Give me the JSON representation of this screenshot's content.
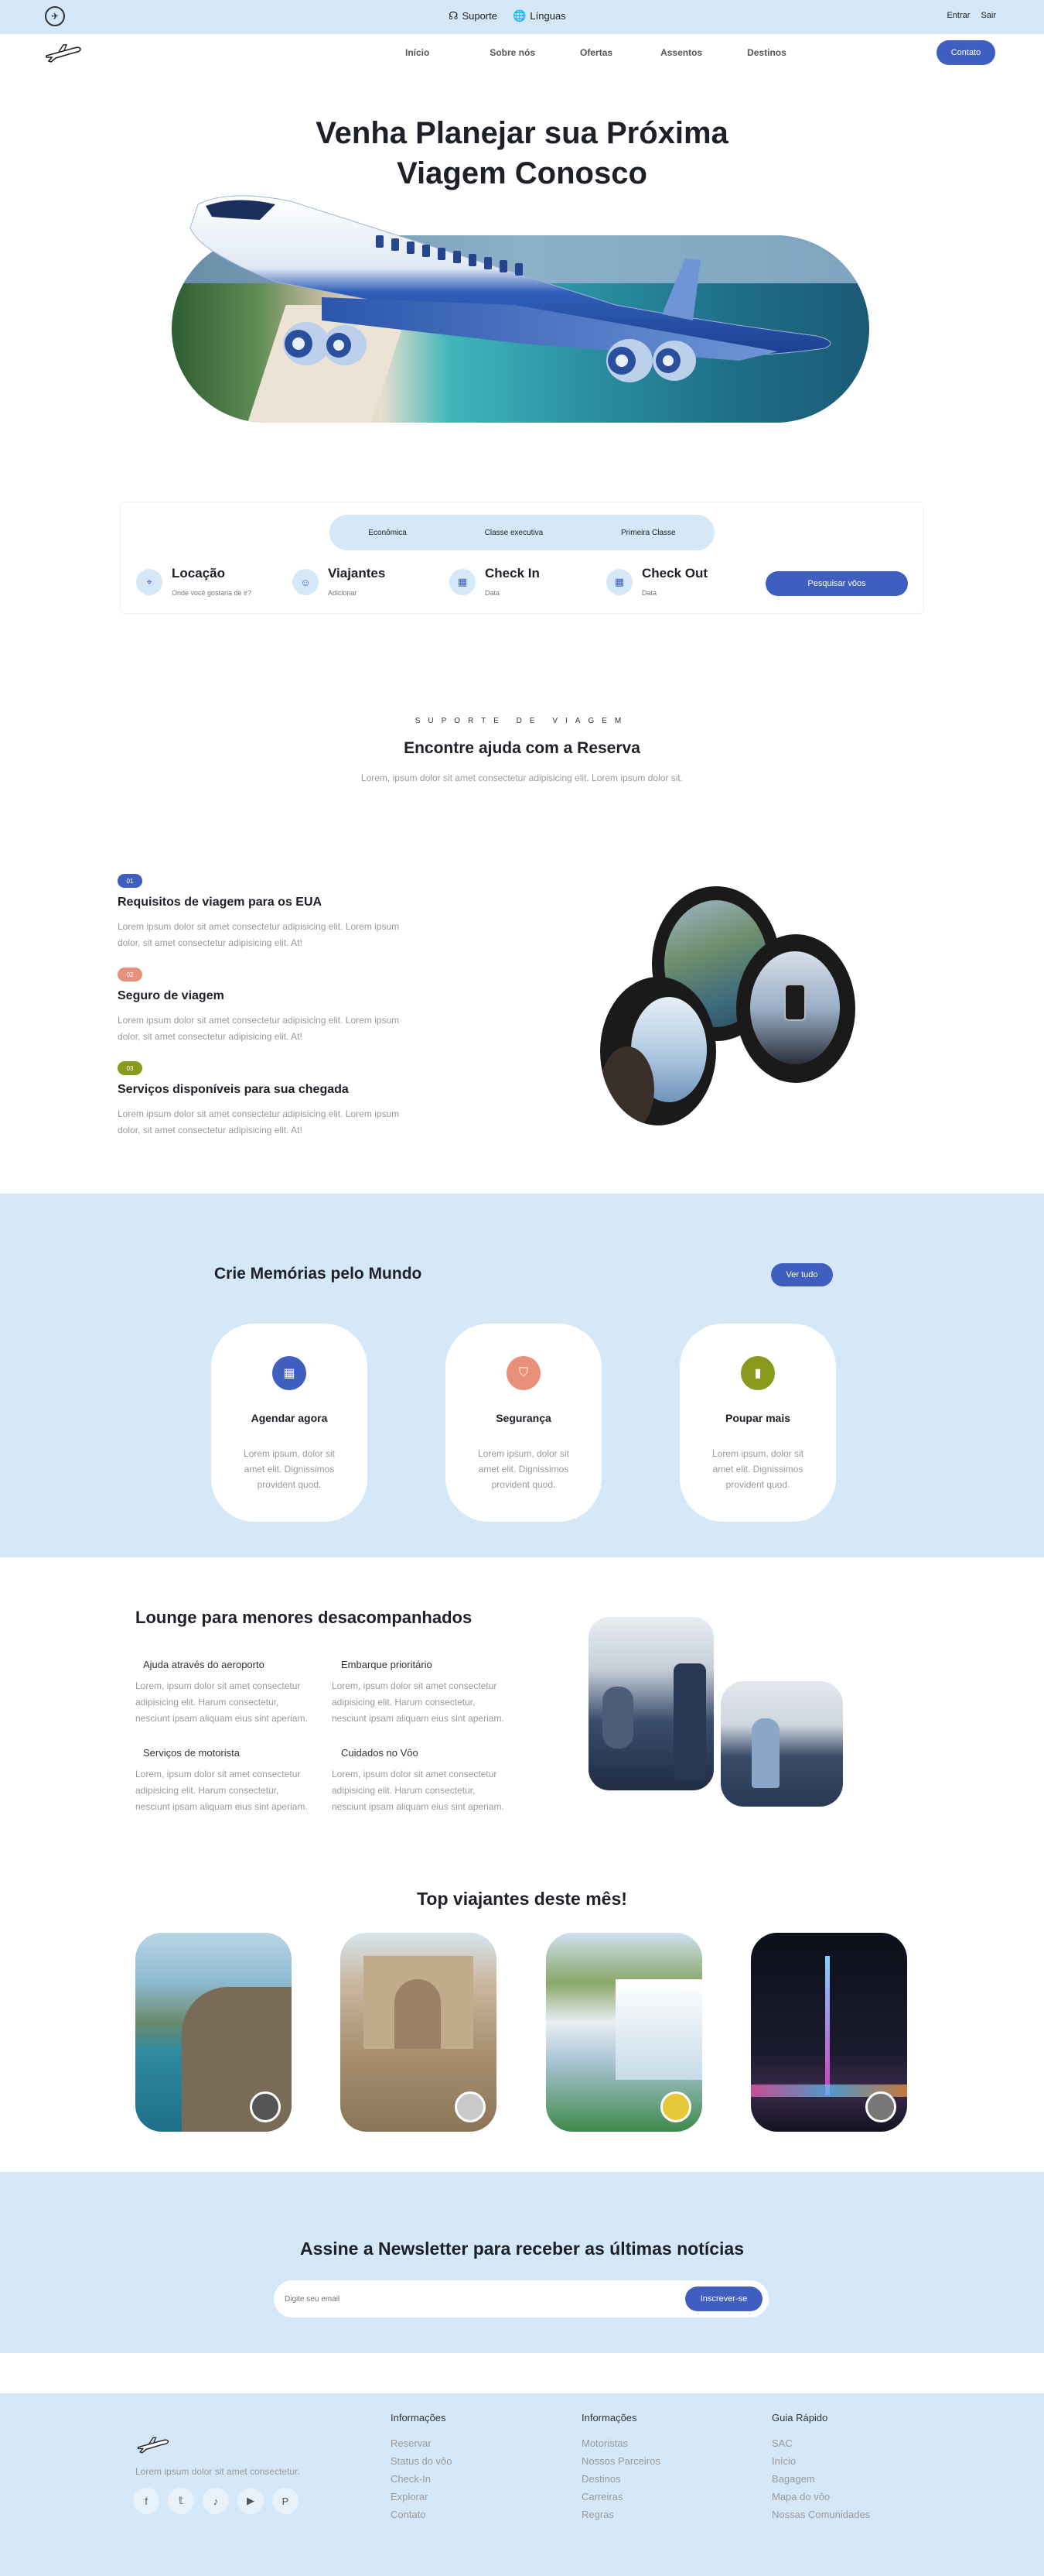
{
  "topbar": {
    "support": "Suporte",
    "languages": "Línguas",
    "login": "Entrar",
    "logout": "Sair"
  },
  "nav": {
    "items": [
      "Início",
      "Sobre nós",
      "Ofertas",
      "Assentos",
      "Destinos"
    ],
    "contact": "Contato"
  },
  "hero": {
    "title_line1": "Venha Planejar sua Próxima",
    "title_line2": "Viagem Conosco"
  },
  "booking": {
    "tabs": [
      "Econômica",
      "Classe executiva",
      "Primeira Classe"
    ],
    "fields": [
      {
        "title": "Locação",
        "sub": "Onde você gostaria de ir?",
        "icon": "map-pin-icon"
      },
      {
        "title": "Viajantes",
        "sub": "Adicionar",
        "icon": "user-icon"
      },
      {
        "title": "Check In",
        "sub": "Data",
        "icon": "calendar-icon"
      },
      {
        "title": "Check Out",
        "sub": "Data",
        "icon": "calendar-icon"
      }
    ],
    "search": "Pesquisar vôos"
  },
  "support": {
    "kicker": "SUPORTE DE VIAGEM",
    "title": "Encontre ajuda com a Reserva",
    "subtitle": "Lorem, ipsum dolor sit amet consectetur adipisicing elit. Lorem ipsum dolor sit.",
    "items": [
      {
        "num": "01",
        "color": "#3f5ebf",
        "title": "Requisitos de viagem para os EUA",
        "text1": "Lorem ipsum dolor sit amet consectetur adipisicing elit. Lorem ipsum",
        "text2": "dolor, sit amet consectetur adipisicing elit. At!"
      },
      {
        "num": "02",
        "color": "#e8907a",
        "title": "Seguro de viagem",
        "text1": "Lorem ipsum dolor sit amet consectetur adipisicing elit. Lorem ipsum",
        "text2": "dolor, sit amet consectetur adipisicing elit. At!"
      },
      {
        "num": "03",
        "color": "#8a9a1d",
        "title": "Serviços disponíveis para sua chegada",
        "text1": "Lorem ipsum dolor sit amet consectetur adipisicing elit. Lorem ipsum",
        "text2": "dolor, sit amet consectetur adipisicing elit. At!"
      }
    ]
  },
  "memories": {
    "title": "Crie Memórias pelo Mundo",
    "see_all": "Ver tudo",
    "cards": [
      {
        "title": "Agendar agora",
        "color": "#3f5ebf",
        "icon": "calendar-icon",
        "l1": "Lorem ipsum, dolor sit",
        "l2": "amet elit. Dignissimos",
        "l3": "provident quod."
      },
      {
        "title": "Segurança",
        "color": "#e8907a",
        "icon": "shield-icon",
        "l1": "Lorem ipsum, dolor sit",
        "l2": "amet elit. Dignissimos",
        "l3": "provident quod."
      },
      {
        "title": "Poupar mais",
        "color": "#8a9a1d",
        "icon": "bookmark-icon",
        "l1": "Lorem ipsum, dolor sit",
        "l2": "amet elit. Dignissimos",
        "l3": "provident quod."
      }
    ]
  },
  "lounge": {
    "title": "Lounge para menores desacompanhados",
    "items": [
      {
        "title": "Ajuda através do aeroporto",
        "l1": "Lorem, ipsum dolor sit amet consectetur",
        "l2": "adipisicing elit. Harum consectetur,",
        "l3": "nesciunt ipsam aliquam eius sint aperiam."
      },
      {
        "title": "Embarque prioritário",
        "l1": "Lorem, ipsum dolor sit amet consectetur",
        "l2": "adipisicing elit. Harum consectetur,",
        "l3": "nesciunt ipsam aliquam eius sint aperiam."
      },
      {
        "title": "Serviços de motorista",
        "l1": "Lorem, ipsum dolor sit amet consectetur",
        "l2": "adipisicing elit. Harum consectetur,",
        "l3": "nesciunt ipsam aliquam eius sint aperiam."
      },
      {
        "title": "Cuidados no Vôo",
        "l1": "Lorem, ipsum dolor sit amet consectetur",
        "l2": "adipisicing elit. Harum consectetur,",
        "l3": "nesciunt ipsam aliquam eius sint aperiam."
      }
    ]
  },
  "travelers": {
    "title": "Top viajantes deste mês!"
  },
  "newsletter": {
    "title": "Assine a Newsletter para receber as últimas notícias",
    "placeholder": "Digite seu email",
    "button": "Inscrever-se"
  },
  "footer": {
    "tagline": "Lorem ipsum dolor sit amet consectetur.",
    "columns": [
      {
        "title": "Informações",
        "links": [
          "Reservar",
          "Status do vôo",
          "Check-In",
          "Explorar",
          "Contato"
        ]
      },
      {
        "title": "Informações",
        "links": [
          "Motoristas",
          "Nossos Parceiros",
          "Destinos",
          "Carreiras",
          "Regras"
        ]
      },
      {
        "title": "Guia Rápido",
        "links": [
          "SAC",
          "Início",
          "Bagagem",
          "Mapa do vôo",
          "Nossas Comunidades"
        ]
      }
    ]
  }
}
